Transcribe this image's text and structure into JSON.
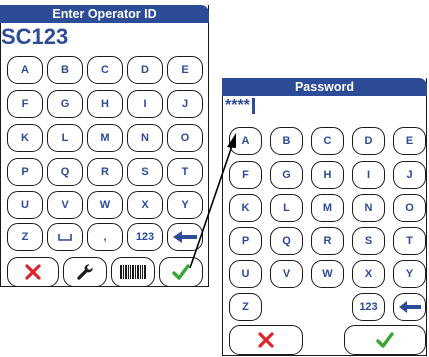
{
  "operator_screen": {
    "title": "Enter Operator ID",
    "entry": "SC123",
    "rows": [
      [
        "A",
        "B",
        "C",
        "D",
        "E"
      ],
      [
        "F",
        "G",
        "H",
        "I",
        "J"
      ],
      [
        "K",
        "L",
        "M",
        "N",
        "O"
      ],
      [
        "P",
        "Q",
        "R",
        "S",
        "T"
      ],
      [
        "U",
        "V",
        "W",
        "X",
        "Y"
      ],
      [
        "Z",
        "",
        ",",
        "123",
        ""
      ]
    ],
    "actions": [
      "cancel-icon",
      "wrench-icon",
      "barcode-icon",
      "checkmark-icon"
    ]
  },
  "password_screen": {
    "title": "Password",
    "entry": "****",
    "rows": [
      [
        "A",
        "B",
        "C",
        "D",
        "E"
      ],
      [
        "F",
        "G",
        "H",
        "I",
        "J"
      ],
      [
        "K",
        "L",
        "M",
        "N",
        "O"
      ],
      [
        "P",
        "Q",
        "R",
        "S",
        "T"
      ],
      [
        "U",
        "V",
        "W",
        "X",
        "Y"
      ],
      [
        "Z",
        "123",
        ""
      ]
    ],
    "actions": [
      "cancel-icon",
      "checkmark-icon"
    ]
  },
  "colors": {
    "accent": "#2d4c98",
    "cancel": "#e0242b",
    "confirm": "#3aa535"
  }
}
